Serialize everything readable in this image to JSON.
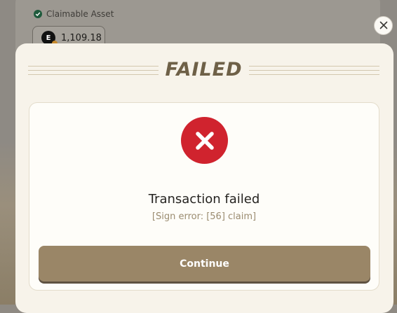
{
  "background": {
    "claimable_label": "Claimable Asset",
    "asset_amount": "1,109.18",
    "token_letter": "E"
  },
  "modal": {
    "title": "FAILED",
    "status_title": "Transaction failed",
    "status_detail": "[Sign error: [56] claim]",
    "continue_label": "Continue",
    "close_icon": "close-icon",
    "status_icon": "error-x-icon"
  },
  "colors": {
    "error_red": "#d0232e",
    "button": "#9a8667",
    "title": "#6e6047",
    "modal_bg": "#f7f3ea"
  }
}
